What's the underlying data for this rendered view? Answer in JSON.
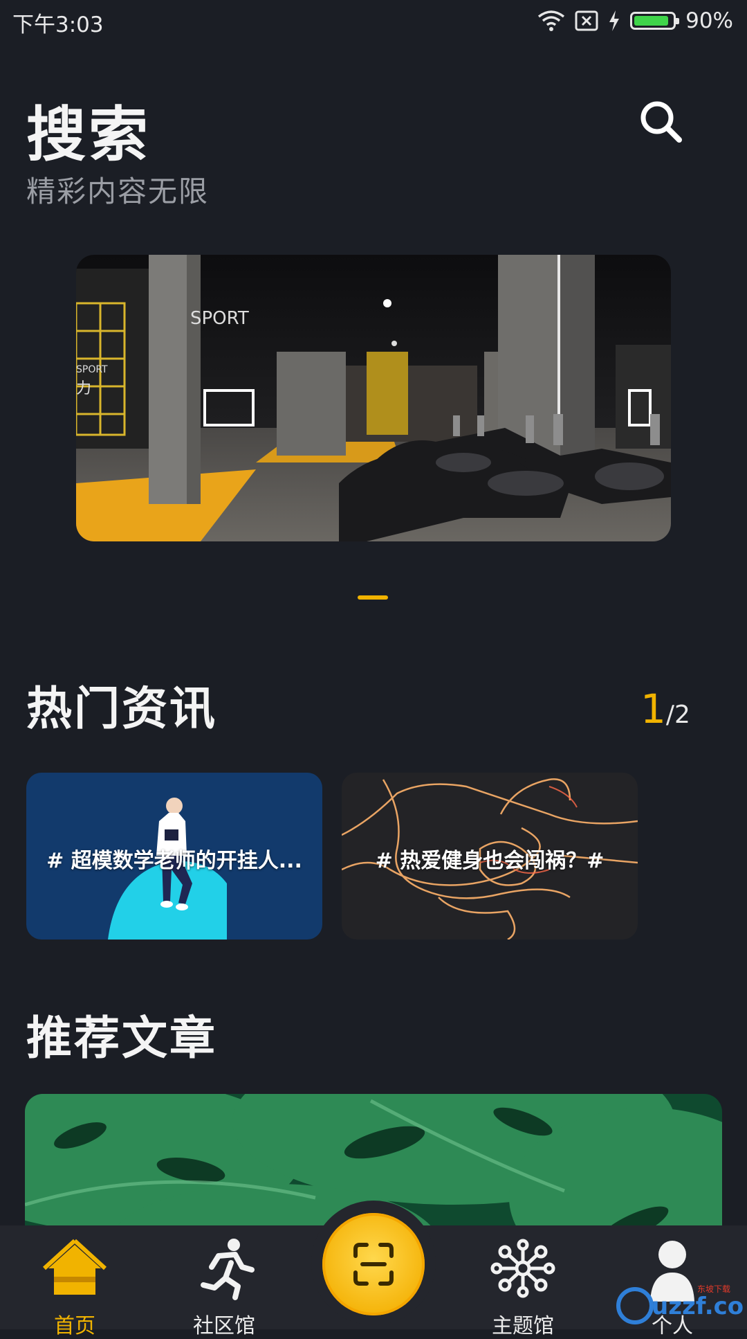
{
  "status_bar": {
    "time": "下午3:03",
    "battery_percent": "90%",
    "battery_level": 0.9
  },
  "header": {
    "title": "搜索",
    "subtitle": "精彩内容无限"
  },
  "banner": {
    "active_page": 1,
    "page_count": 1,
    "sign_text_1": "SPORT",
    "sign_text_2": "SPORT",
    "sign_text_3": "力"
  },
  "hot_news": {
    "title": "热门资讯",
    "pager": {
      "current": "1",
      "separator": "/",
      "total": "2"
    },
    "cards": [
      {
        "label": "# 超模数学老师的开挂人..."
      },
      {
        "label": "# 热爱健身也会闯祸？#"
      }
    ]
  },
  "recommended": {
    "title": "推荐文章"
  },
  "nav": {
    "items": [
      {
        "label": "首页",
        "icon": "home-icon",
        "active": true
      },
      {
        "label": "社区馆",
        "icon": "running-person-icon",
        "active": false
      },
      {
        "label": "",
        "icon": "scan-icon",
        "active": false
      },
      {
        "label": "主题馆",
        "icon": "molecule-icon",
        "active": false
      },
      {
        "label": "个人",
        "icon": "person-icon",
        "active": false
      }
    ]
  },
  "watermark": {
    "text": "uzzf.com",
    "tag": "东坡下载"
  },
  "colors": {
    "background": "#1b1e25",
    "accent": "#f1b300",
    "nav_bg": "#24262d"
  }
}
